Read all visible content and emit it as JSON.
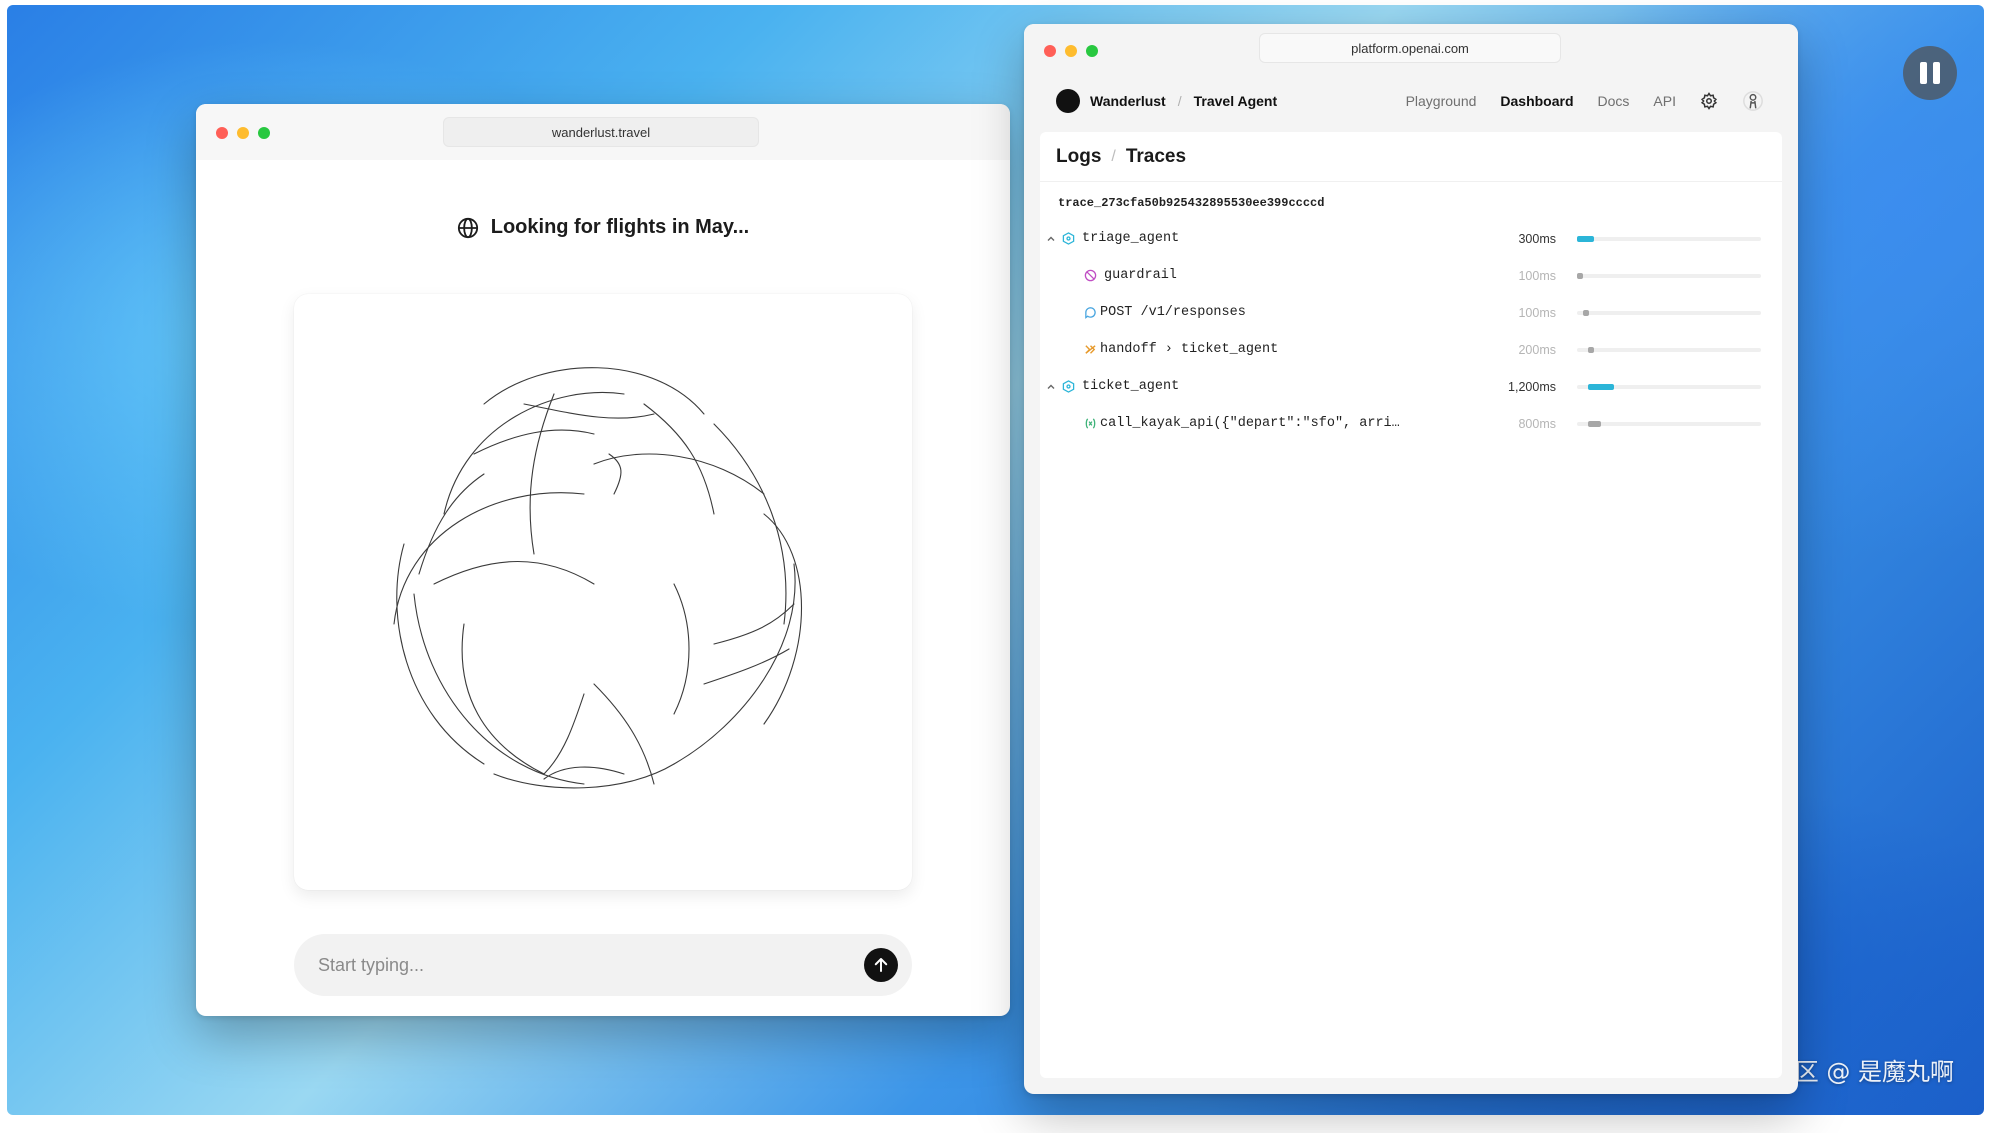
{
  "left_window": {
    "url": "wanderlust.travel",
    "status_text": "Looking for flights in May...",
    "input": {
      "placeholder": "Start typing..."
    }
  },
  "right_window": {
    "url": "platform.openai.com",
    "breadcrumb": {
      "org": "Wanderlust",
      "project": "Travel Agent"
    },
    "nav": [
      {
        "label": "Playground",
        "active": false
      },
      {
        "label": "Dashboard",
        "active": true
      },
      {
        "label": "Docs",
        "active": false
      },
      {
        "label": "API",
        "active": false
      }
    ],
    "panel": {
      "crumb_logs": "Logs",
      "crumb_traces": "Traces",
      "trace_id": "trace_273cfa50b925432895530ee399ccccd",
      "rows": [
        {
          "label": "triage_agent",
          "duration": "300ms",
          "icon": "agent-icon",
          "icon_color": "#2bb5d8",
          "bar_color": "#2bb5d8",
          "start": 0.0,
          "fraction": 0.09
        },
        {
          "label": "guardrail",
          "duration": "100ms",
          "icon": "guardrail-icon",
          "icon_color": "#c04ec4",
          "bar_color": "#a7a7a7",
          "start": 0.0,
          "fraction": 0.03
        },
        {
          "label": "POST /v1/responses",
          "duration": "100ms",
          "icon": "response-icon",
          "icon_color": "#4aa6e0",
          "bar_color": "#a7a7a7",
          "start": 0.03,
          "fraction": 0.03
        },
        {
          "label": "handoff › ticket_agent",
          "duration": "200ms",
          "icon": "handoff-icon",
          "icon_color": "#e79a2c",
          "bar_color": "#a7a7a7",
          "start": 0.06,
          "fraction": 0.03
        },
        {
          "label": "ticket_agent",
          "duration": "1,200ms",
          "icon": "agent-icon",
          "icon_color": "#2bb5d8",
          "bar_color": "#2bb5d8",
          "start": 0.06,
          "fraction": 0.14
        },
        {
          "label": "call_kayak_api({\"depart\":\"sfo\", arri…",
          "duration": "800ms",
          "icon": "function-icon",
          "icon_color": "#3fb37a",
          "bar_color": "#a7a7a7",
          "start": 0.06,
          "fraction": 0.07
        }
      ]
    }
  },
  "watermark": "掘金技术社区 @ 是魔丸啊"
}
